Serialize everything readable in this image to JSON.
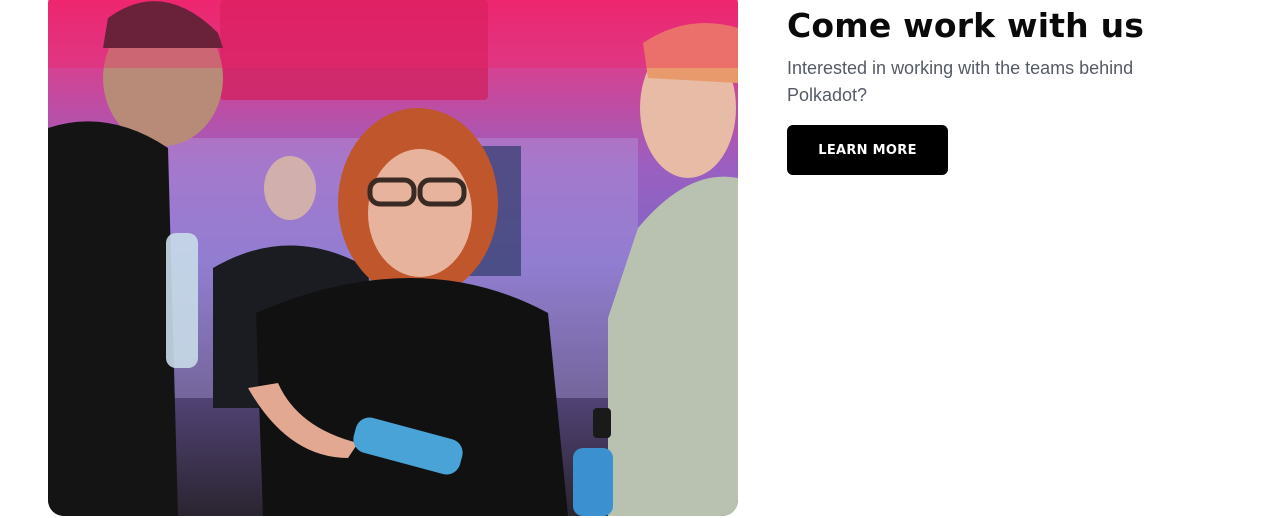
{
  "section": {
    "title": "Come work with us",
    "subtitle": "Interested in working with the teams behind Polkadot?",
    "button_label": "LEARN MORE",
    "photo_description_icon": "people-photo"
  },
  "colors": {
    "accent_pink": "#f0236b",
    "purple": "#7e67c6",
    "button_bg": "#000000",
    "button_text": "#ffffff",
    "title_text": "#0a0a0a",
    "subtitle_text": "#555b66"
  }
}
